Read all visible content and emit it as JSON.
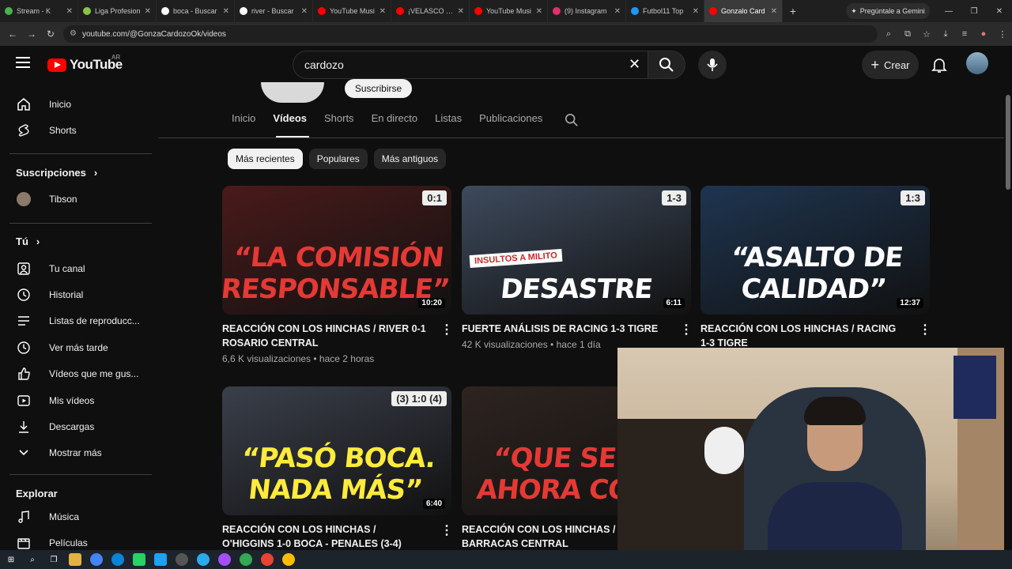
{
  "browser": {
    "tabs": [
      {
        "label": "Stream - K",
        "color": "#4caf50"
      },
      {
        "label": "Liga Profesion",
        "color": "#8bc34a"
      },
      {
        "label": "boca - Buscar",
        "color": "#ffffff"
      },
      {
        "label": "river - Buscar",
        "color": "#ffffff"
      },
      {
        "label": "YouTube Musi",
        "color": "#ff0000"
      },
      {
        "label": "¡VELASCO SAC",
        "color": "#ff0000"
      },
      {
        "label": "YouTube Musi",
        "color": "#ff0000"
      },
      {
        "label": "(9) Instagram",
        "color": "#e1306c"
      },
      {
        "label": "Futbol11 Top",
        "color": "#2196f3"
      },
      {
        "label": "Gonzalo Card",
        "color": "#ff0000"
      }
    ],
    "gemini_label": "Pregúntale a Gemini",
    "url": "youtube.com/@GonzaCardozoOk/videos"
  },
  "header": {
    "logo_text": "YouTube",
    "country": "AR",
    "search_value": "cardozo",
    "create_label": "Crear"
  },
  "sidebar": {
    "main": [
      {
        "label": "Inicio",
        "icon": "home-icon"
      },
      {
        "label": "Shorts",
        "icon": "shorts-icon"
      }
    ],
    "subscriptions_title": "Suscripciones",
    "subscriptions": [
      {
        "label": "Tibson"
      }
    ],
    "you_title": "Tú",
    "you_items": [
      {
        "label": "Tu canal",
        "icon": "channel-icon"
      },
      {
        "label": "Historial",
        "icon": "history-icon"
      },
      {
        "label": "Listas de reproducc...",
        "icon": "playlist-icon"
      },
      {
        "label": "Ver más tarde",
        "icon": "clock-icon"
      },
      {
        "label": "Vídeos que me gus...",
        "icon": "like-icon"
      },
      {
        "label": "Mis vídeos",
        "icon": "video-icon"
      },
      {
        "label": "Descargas",
        "icon": "download-icon"
      },
      {
        "label": "Mostrar más",
        "icon": "chevron-down-icon"
      }
    ],
    "explore_title": "Explorar",
    "explore": [
      {
        "label": "Música",
        "icon": "music-icon"
      },
      {
        "label": "Películas",
        "icon": "movie-icon"
      }
    ]
  },
  "channel": {
    "subscribe_label": "Suscribirse",
    "tabs": [
      "Inicio",
      "Vídeos",
      "Shorts",
      "En directo",
      "Listas",
      "Publicaciones"
    ],
    "chips": [
      "Más recientes",
      "Populares",
      "Más antiguos"
    ]
  },
  "videos": [
    {
      "thumb_text": "“LA COMISIÓN RESPONSABLE”",
      "duration": "10:20",
      "score": "0:1",
      "title": "REACCIÓN CON LOS HINCHAS / RIVER 0-1 ROSARIO CENTRAL",
      "meta": "6,6 K visualizaciones • hace 2 horas",
      "bg": "#4a1a1a",
      "fg": "#e53935"
    },
    {
      "thumb_text": "DESASTRE",
      "duration": "6:11",
      "score": "1-3",
      "title": "FUERTE ANÁLISIS DE RACING 1-3 TIGRE",
      "meta": "42 K visualizaciones • hace 1 día",
      "bg": "#3d4a5c",
      "fg": "#ffffff",
      "badge": "INSULTOS A MILITO"
    },
    {
      "thumb_text": "“ASALTO DE CALIDAD”",
      "duration": "12:37",
      "score": "1:3",
      "title": "REACCIÓN CON LOS HINCHAS / RACING 1-3 TIGRE",
      "meta": "",
      "bg": "#1e3550",
      "fg": "#ffffff"
    },
    {
      "thumb_text": "“PASÓ BOCA. NADA MÁS”",
      "duration": "6:40",
      "score": "(3) 1:0 (4)",
      "title": "REACCIÓN CON LOS HINCHAS / O'HIGGINS 1-0 BOCA - PENALES (3-4)",
      "meta": "",
      "bg": "#3a3f4a",
      "fg": "#ffeb3b"
    },
    {
      "thumb_text": "“QUE SE VA AHORA COUD",
      "duration": "",
      "score": "",
      "title": "REACCIÓN CON LOS HINCHAS / I BARRACAS CENTRAL",
      "meta": "",
      "bg": "#2e2420",
      "fg": "#e53935"
    }
  ]
}
